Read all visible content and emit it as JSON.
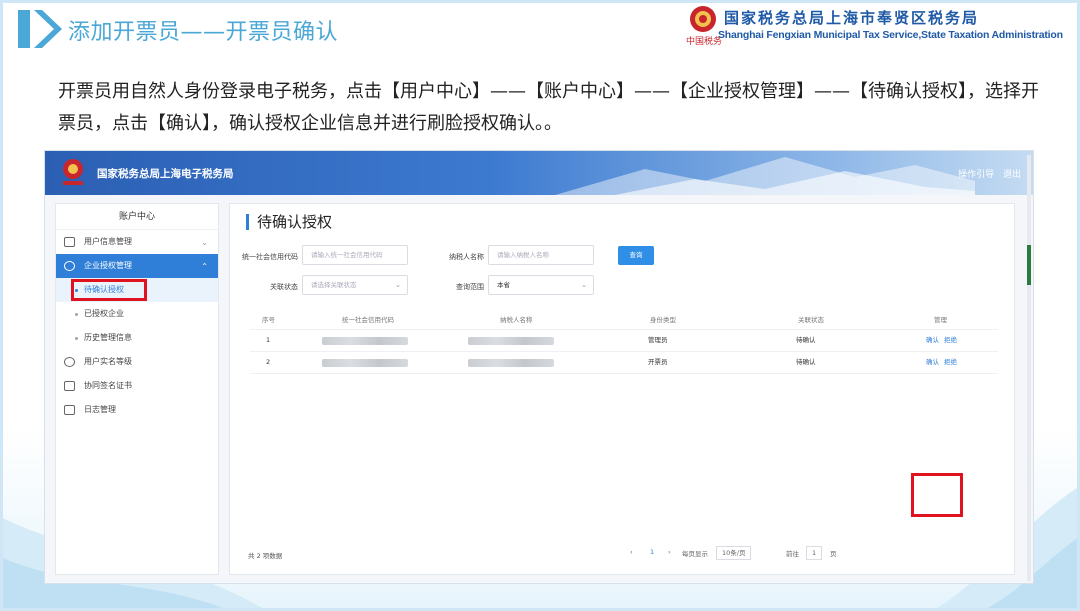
{
  "slide": {
    "title": "添加开票员——开票员确认",
    "org_name_cn": "国家税务总局上海市奉贤区税务局",
    "org_name_en": "Shanghai Fengxian Municipal Tax Service,State Taxation Administration",
    "org_sub_emblem": "中国税务",
    "instruction": "开票员用自然人身份登录电子税务，点击【用户中心】——【账户中心】——【企业授权管理】——【待确认授权】，选择开票员，点击【确认】，确认授权企业信息并进行刷脸授权确认。。"
  },
  "app": {
    "title": "国家税务总局上海电子税务局",
    "logo_caption": "中国税务",
    "header_links": [
      "操作引导",
      "退出"
    ],
    "sidebar": {
      "heading": "账户中心",
      "items": [
        {
          "label": "用户信息管理",
          "icon": "id-card-icon",
          "chevron": "⌄"
        },
        {
          "label": "企业授权管理",
          "icon": "shield-icon",
          "chevron": "⌃",
          "active": true
        },
        {
          "label": "用户实名等级",
          "icon": "user-icon"
        },
        {
          "label": "协同签名证书",
          "icon": "certificate-icon"
        },
        {
          "label": "日志管理",
          "icon": "log-icon"
        }
      ],
      "subitems": [
        "待确认授权",
        "已授权企业",
        "历史管理信息"
      ]
    },
    "panel": {
      "title": "待确认授权",
      "filters": {
        "credit_code_label": "统一社会信用代码",
        "credit_code_placeholder": "请输入统一社会信用代码",
        "taxpayer_name_label": "纳税人名称",
        "taxpayer_name_placeholder": "请输入纳税人名称",
        "relation_status_label": "关联状态",
        "relation_status_placeholder": "请选择关联状态",
        "query_range_label": "查询范围",
        "query_range_value": "本省",
        "query_button": "查询"
      },
      "table": {
        "columns": [
          "序号",
          "统一社会信用代码",
          "纳税人名称",
          "身份类型",
          "关联状态",
          "管理"
        ],
        "rows": [
          {
            "index": "1",
            "identity_type": "管理员",
            "status": "待确认",
            "actions": [
              "确认",
              "拒绝"
            ]
          },
          {
            "index": "2",
            "identity_type": "开票员",
            "status": "待确认",
            "actions": [
              "确认",
              "拒绝"
            ]
          }
        ]
      },
      "footer": {
        "total": "共 2 项数据",
        "prev": "‹",
        "current_page": "1",
        "next": "›",
        "per_page_label": "每页显示",
        "per_page_value": "10条/页",
        "goto_label": "前往",
        "goto_value": "1",
        "page_unit": "页"
      }
    }
  },
  "colors": {
    "accent": "#2f7fd9",
    "highlight": "#e0121f",
    "title": "#4aa7d6",
    "org": "#1f5aa6"
  }
}
